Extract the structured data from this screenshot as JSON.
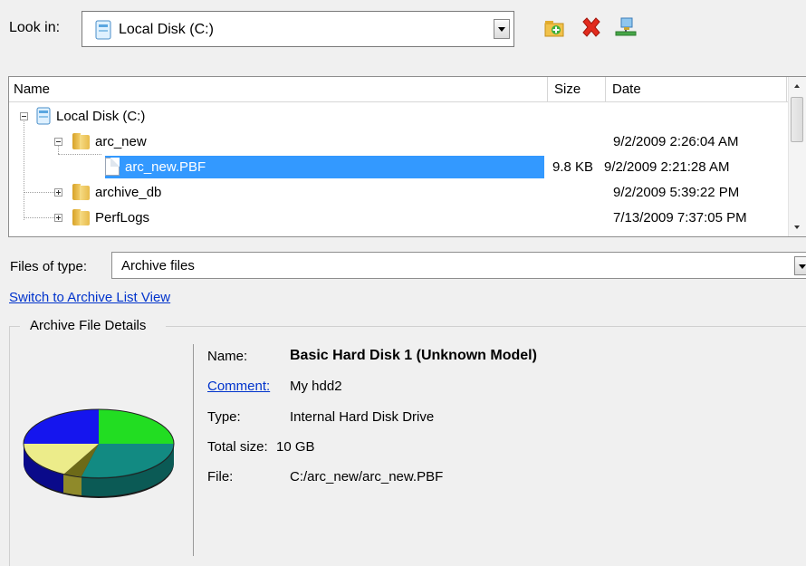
{
  "look_in": {
    "label": "Look in:",
    "value": "Local Disk (C:)"
  },
  "toolbar": {
    "icons": [
      "new-folder-icon",
      "delete-icon",
      "network-icon"
    ]
  },
  "tree": {
    "columns": [
      "Name",
      "Size",
      "Date"
    ],
    "rows": [
      {
        "name": "Local Disk (C:)",
        "size": "",
        "date": "",
        "type": "drive",
        "expanded": true
      },
      {
        "name": "arc_new",
        "size": "",
        "date": "9/2/2009 2:26:04 AM",
        "type": "folder",
        "expanded": true
      },
      {
        "name": "arc_new.PBF",
        "size": "9.8 KB",
        "date": "9/2/2009 2:21:28 AM",
        "type": "file",
        "selected": true
      },
      {
        "name": "archive_db",
        "size": "",
        "date": "9/2/2009 5:39:22 PM",
        "type": "folder",
        "expanded": false
      },
      {
        "name": "PerfLogs",
        "size": "",
        "date": "7/13/2009 7:37:05 PM",
        "type": "folder",
        "expanded": false
      }
    ]
  },
  "files_of_type": {
    "label": "Files of type:",
    "value": "Archive files"
  },
  "switch_link": "Switch to Archive List View",
  "details": {
    "group_title": "Archive File Details",
    "name_label": "Name:",
    "name_value": "Basic Hard Disk 1 (Unknown Model)",
    "comment_label": "Comment:",
    "comment_value": "My hdd2",
    "type_label": "Type:",
    "type_value": "Internal Hard Disk Drive",
    "total_size_label": "Total size:",
    "total_size_value": "10 GB",
    "file_label": "File:",
    "file_value": "C:/arc_new/arc_new.PBF"
  },
  "colors": {
    "selection": "#3399ff",
    "link": "#0033cc"
  }
}
